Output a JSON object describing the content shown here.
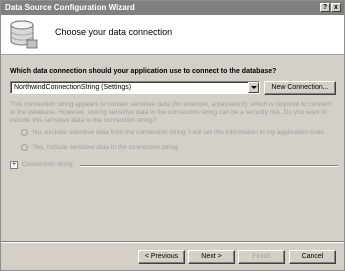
{
  "window": {
    "title": "Data Source Configuration Wizard"
  },
  "titlebar_buttons": {
    "help": "?",
    "close": "x"
  },
  "header": {
    "title": "Choose your data connection",
    "icon": "database-icon"
  },
  "connection": {
    "question": "Which data connection should your application use to connect to the database?",
    "selected": "NorthwindConnectionString (Settings)",
    "new_button": "New Connection..."
  },
  "sensitive": {
    "text": "This connection string appears to contain sensitive data (for example, a password), which is required to connect to the database. However, storing sensitive data in the connection string can be a security risk. Do you want to include this sensitive data in the connection string?",
    "option_no": "No, exclude sensitive data from the connection string. I will set this information in my application code.",
    "option_yes": "Yes, include sensitive data in the connection string."
  },
  "connection_string": {
    "expander": "+",
    "label": "Connection string"
  },
  "footer": {
    "previous": "< Previous",
    "next": "Next >",
    "finish": "Finish",
    "cancel": "Cancel"
  }
}
